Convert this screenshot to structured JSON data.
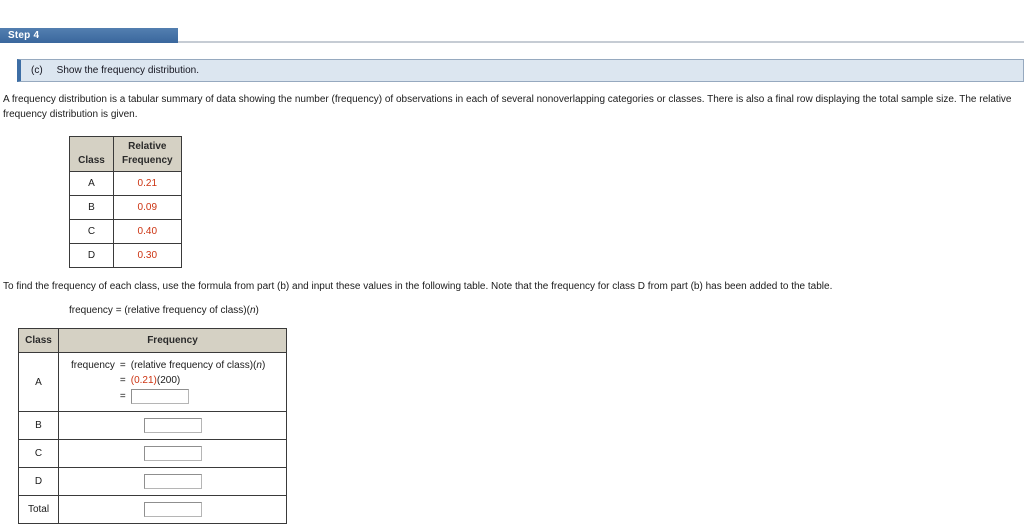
{
  "colors": {
    "accent_blue": "#3d6ea5",
    "step_bar_blue": "#40699e",
    "callout_bg": "#dce6f0",
    "table_header_bg": "#d5d1c4",
    "value_red": "#cc3311"
  },
  "header": {
    "step_label": "Step 4"
  },
  "question": {
    "part_label": "(c)",
    "text": "Show the frequency distribution."
  },
  "intro_paragraph": "A frequency distribution is a tabular summary of data showing the number (frequency) of observations in each of several nonoverlapping categories or classes. There is also a final row displaying the total sample size. The relative frequency distribution is given.",
  "relative_frequency_table": {
    "headers": {
      "class": "Class",
      "relative_frequency": "Relative\nFrequency"
    },
    "rows": [
      {
        "class": "A",
        "value": "0.21"
      },
      {
        "class": "B",
        "value": "0.09"
      },
      {
        "class": "C",
        "value": "0.40"
      },
      {
        "class": "D",
        "value": "0.30"
      }
    ]
  },
  "instruction_paragraph": "To find the frequency of each class, use the formula from part (b) and input these values in the following table. Note that the frequency for class D from part (b) has been added to the table.",
  "formula": {
    "lhs": "frequency",
    "equals": "=",
    "rhs_prefix": "(relative frequency of class)(",
    "rhs_variable": "n",
    "rhs_suffix": ")"
  },
  "frequency_table": {
    "headers": {
      "class": "Class",
      "frequency": "Frequency"
    },
    "row_a": {
      "class": "A",
      "work_line_2": {
        "equals": "=",
        "red_factor": "(0.21)",
        "black_factor": "(200)"
      },
      "work_line_3": {
        "equals": "="
      },
      "input_value": ""
    },
    "rows": [
      {
        "class": "B",
        "input_value": ""
      },
      {
        "class": "C",
        "input_value": ""
      },
      {
        "class": "D",
        "input_value": ""
      },
      {
        "class": "Total",
        "input_value": ""
      }
    ]
  }
}
